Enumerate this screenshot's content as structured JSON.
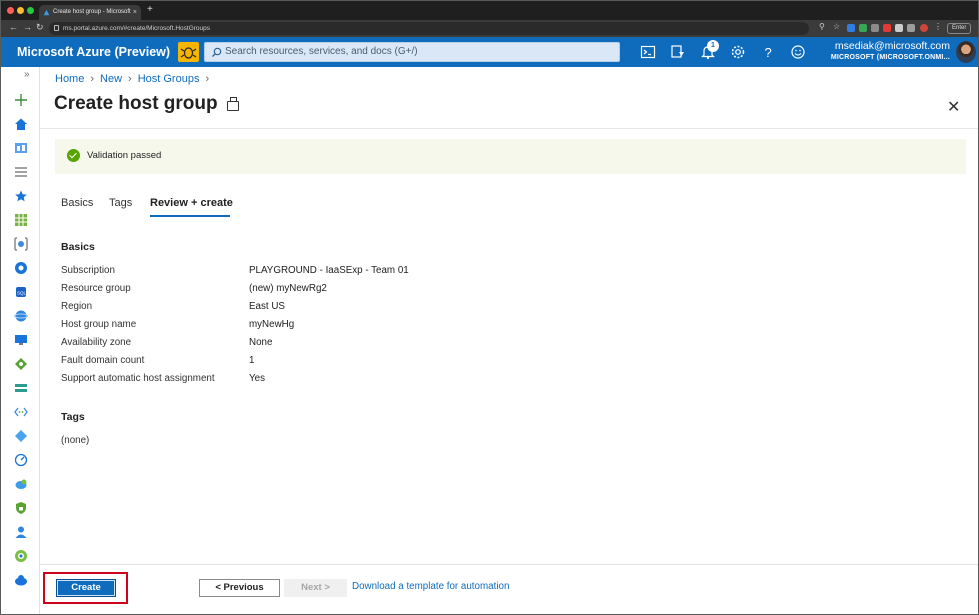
{
  "browser": {
    "tab_title": "Create host group - Microsoft",
    "tab_close": "×",
    "new_tab": "+",
    "url": "ms.portal.azure.com/#create/Microsoft.HostGroups",
    "enter_label": "Enter"
  },
  "header": {
    "brand": "Microsoft Azure (Preview)",
    "search_placeholder": "Search resources, services, and docs (G+/)",
    "notification_count": "1",
    "user_email": "msediak@microsoft.com",
    "tenant": "MICROSOFT (MICROSOFT.ONMI..."
  },
  "breadcrumb": {
    "items": [
      "Home",
      "New",
      "Host Groups"
    ]
  },
  "page": {
    "title": "Create host group"
  },
  "validation": {
    "message": "Validation passed",
    "status_color": "#57a300"
  },
  "tabs": [
    {
      "label": "Basics"
    },
    {
      "label": "Tags"
    },
    {
      "label": "Review + create",
      "active": true
    }
  ],
  "basics": {
    "heading": "Basics",
    "rows": [
      {
        "label": "Subscription",
        "value": "PLAYGROUND - IaaSExp - Team 01"
      },
      {
        "label": "Resource group",
        "value": "(new) myNewRg2"
      },
      {
        "label": "Region",
        "value": "East US"
      },
      {
        "label": "Host group name",
        "value": "myNewHg"
      },
      {
        "label": "Availability zone",
        "value": "None"
      },
      {
        "label": "Fault domain count",
        "value": "1"
      },
      {
        "label": "Support automatic host assignment",
        "value": "Yes"
      }
    ]
  },
  "tags": {
    "heading": "Tags",
    "value": "(none)"
  },
  "footer": {
    "create_label": "Create",
    "previous_label": "< Previous",
    "next_label": "Next >",
    "template_link": "Download a template for automation"
  },
  "colors": {
    "accent": "#0f6cbd",
    "highlight": "#d0021b"
  }
}
